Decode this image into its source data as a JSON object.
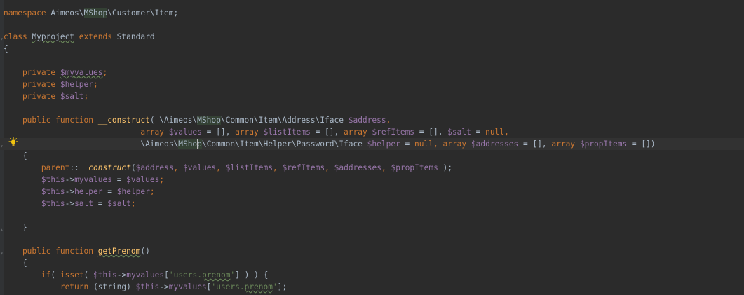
{
  "lines": [
    {
      "row": 0,
      "tokens": [
        {
          "t": "namespace ",
          "c": "kw"
        },
        {
          "t": "Aimeos\\",
          "c": "plain"
        },
        {
          "t": "MShop",
          "c": "hl"
        },
        {
          "t": "\\Customer\\Item;",
          "c": "plain"
        }
      ]
    },
    {
      "row": 2,
      "tokens": [
        {
          "t": "class ",
          "c": "kw"
        },
        {
          "t": "Myproject",
          "c": "plain",
          "u": true
        },
        {
          "t": " extends ",
          "c": "kw"
        },
        {
          "t": "Standard",
          "c": "plain"
        }
      ]
    },
    {
      "row": 3,
      "tokens": [
        {
          "t": "{",
          "c": "plain"
        }
      ]
    },
    {
      "row": 5,
      "tokens": [
        {
          "t": "    private ",
          "c": "kw"
        },
        {
          "t": "$myvalues",
          "c": "var",
          "u": true
        },
        {
          "t": ";",
          "c": "kw"
        }
      ]
    },
    {
      "row": 6,
      "tokens": [
        {
          "t": "    private ",
          "c": "kw"
        },
        {
          "t": "$helper",
          "c": "var"
        },
        {
          "t": ";",
          "c": "kw"
        }
      ]
    },
    {
      "row": 7,
      "tokens": [
        {
          "t": "    private ",
          "c": "kw"
        },
        {
          "t": "$salt",
          "c": "var"
        },
        {
          "t": ";",
          "c": "kw"
        }
      ]
    },
    {
      "row": 9,
      "tokens": [
        {
          "t": "    public function ",
          "c": "kw"
        },
        {
          "t": "__construct",
          "c": "fn"
        },
        {
          "t": "( \\Aimeos\\",
          "c": "plain"
        },
        {
          "t": "MShop",
          "c": "hl"
        },
        {
          "t": "\\Common\\Item\\Address\\Iface ",
          "c": "plain"
        },
        {
          "t": "$address",
          "c": "var"
        },
        {
          "t": ",",
          "c": "kw"
        }
      ]
    },
    {
      "row": 10,
      "tokens": [
        {
          "t": "                             ",
          "c": "plain"
        },
        {
          "t": "array ",
          "c": "kw"
        },
        {
          "t": "$values",
          "c": "var"
        },
        {
          "t": " = [], ",
          "c": "plain"
        },
        {
          "t": "array ",
          "c": "kw"
        },
        {
          "t": "$listItems",
          "c": "var"
        },
        {
          "t": " = [], ",
          "c": "plain"
        },
        {
          "t": "array ",
          "c": "kw"
        },
        {
          "t": "$refItems",
          "c": "var"
        },
        {
          "t": " = [], ",
          "c": "plain"
        },
        {
          "t": "$salt",
          "c": "var"
        },
        {
          "t": " = ",
          "c": "plain"
        },
        {
          "t": "null",
          "c": "kw"
        },
        {
          "t": ",",
          "c": "kw"
        }
      ]
    },
    {
      "row": 11,
      "caret": true,
      "tokens": [
        {
          "t": "                             \\Aimeos\\",
          "c": "plain"
        },
        {
          "t": "MShop",
          "c": "hl"
        },
        {
          "t": "\\Common\\Item\\Helper\\Password\\Iface ",
          "c": "plain"
        },
        {
          "t": "$helper",
          "c": "var"
        },
        {
          "t": " = ",
          "c": "plain"
        },
        {
          "t": "null",
          "c": "kw"
        },
        {
          "t": ", ",
          "c": "kw"
        },
        {
          "t": "array ",
          "c": "kw"
        },
        {
          "t": "$addresses",
          "c": "var"
        },
        {
          "t": " = [], ",
          "c": "plain"
        },
        {
          "t": "array ",
          "c": "kw"
        },
        {
          "t": "$propItems",
          "c": "var"
        },
        {
          "t": " = [])",
          "c": "plain"
        }
      ]
    },
    {
      "row": 12,
      "tokens": [
        {
          "t": "    {",
          "c": "plain"
        }
      ]
    },
    {
      "row": 13,
      "tokens": [
        {
          "t": "        ",
          "c": "plain"
        },
        {
          "t": "parent",
          "c": "kw"
        },
        {
          "t": "::",
          "c": "plain"
        },
        {
          "t": "__construct",
          "c": "fn",
          "i": true
        },
        {
          "t": "(",
          "c": "plain"
        },
        {
          "t": "$address",
          "c": "var"
        },
        {
          "t": ", ",
          "c": "kw"
        },
        {
          "t": "$values",
          "c": "var"
        },
        {
          "t": ", ",
          "c": "kw"
        },
        {
          "t": "$listItems",
          "c": "var"
        },
        {
          "t": ", ",
          "c": "kw"
        },
        {
          "t": "$refItems",
          "c": "var"
        },
        {
          "t": ", ",
          "c": "kw"
        },
        {
          "t": "$addresses",
          "c": "var"
        },
        {
          "t": ", ",
          "c": "kw"
        },
        {
          "t": "$propItems",
          "c": "var"
        },
        {
          "t": " );",
          "c": "plain"
        }
      ]
    },
    {
      "row": 14,
      "tokens": [
        {
          "t": "        ",
          "c": "plain"
        },
        {
          "t": "$this",
          "c": "var"
        },
        {
          "t": "->",
          "c": "plain"
        },
        {
          "t": "myvalues",
          "c": "var"
        },
        {
          "t": " = ",
          "c": "plain"
        },
        {
          "t": "$values",
          "c": "var"
        },
        {
          "t": ";",
          "c": "kw"
        }
      ]
    },
    {
      "row": 15,
      "tokens": [
        {
          "t": "        ",
          "c": "plain"
        },
        {
          "t": "$this",
          "c": "var"
        },
        {
          "t": "->",
          "c": "plain"
        },
        {
          "t": "helper",
          "c": "var"
        },
        {
          "t": " = ",
          "c": "plain"
        },
        {
          "t": "$helper",
          "c": "var"
        },
        {
          "t": ";",
          "c": "kw"
        }
      ]
    },
    {
      "row": 16,
      "tokens": [
        {
          "t": "        ",
          "c": "plain"
        },
        {
          "t": "$this",
          "c": "var"
        },
        {
          "t": "->",
          "c": "plain"
        },
        {
          "t": "salt",
          "c": "var"
        },
        {
          "t": " = ",
          "c": "plain"
        },
        {
          "t": "$salt",
          "c": "var"
        },
        {
          "t": ";",
          "c": "kw"
        }
      ]
    },
    {
      "row": 18,
      "tokens": [
        {
          "t": "    }",
          "c": "plain"
        }
      ]
    },
    {
      "row": 20,
      "tokens": [
        {
          "t": "    public function ",
          "c": "kw"
        },
        {
          "t": "getPrenom",
          "c": "fn",
          "u": true
        },
        {
          "t": "()",
          "c": "plain"
        }
      ]
    },
    {
      "row": 21,
      "tokens": [
        {
          "t": "    {",
          "c": "plain"
        }
      ]
    },
    {
      "row": 22,
      "tokens": [
        {
          "t": "        ",
          "c": "plain"
        },
        {
          "t": "if",
          "c": "kw"
        },
        {
          "t": "( ",
          "c": "plain"
        },
        {
          "t": "isset",
          "c": "kw"
        },
        {
          "t": "( ",
          "c": "plain"
        },
        {
          "t": "$this",
          "c": "var"
        },
        {
          "t": "->",
          "c": "plain"
        },
        {
          "t": "myvalues",
          "c": "var"
        },
        {
          "t": "[",
          "c": "plain"
        },
        {
          "t": "'users.",
          "c": "str"
        },
        {
          "t": "prenom",
          "c": "str",
          "u": true
        },
        {
          "t": "'",
          "c": "str"
        },
        {
          "t": "] ) ) {",
          "c": "plain"
        }
      ]
    },
    {
      "row": 23,
      "tokens": [
        {
          "t": "            ",
          "c": "plain"
        },
        {
          "t": "return ",
          "c": "kw"
        },
        {
          "t": "(string) ",
          "c": "plain"
        },
        {
          "t": "$this",
          "c": "var"
        },
        {
          "t": "->",
          "c": "plain"
        },
        {
          "t": "myvalues",
          "c": "var"
        },
        {
          "t": "[",
          "c": "plain"
        },
        {
          "t": "'users.",
          "c": "str"
        },
        {
          "t": "prenom",
          "c": "str",
          "u": true
        },
        {
          "t": "'",
          "c": "str"
        },
        {
          "t": "];",
          "c": "plain"
        }
      ]
    }
  ],
  "icons": {
    "bulb": "lightbulb-icon",
    "fold": "fold-marker-icon"
  },
  "colors": {
    "background": "#2b2b2b",
    "keyword": "#cc7832",
    "variable": "#9876aa",
    "string": "#6a8759",
    "function": "#ffc66d",
    "plain": "#a9b7c6",
    "bulb": "#f1c40f"
  }
}
